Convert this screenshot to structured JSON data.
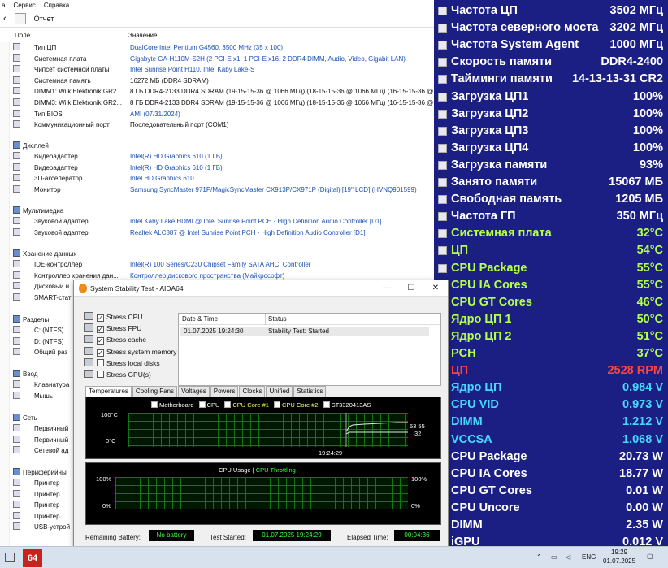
{
  "menu": [
    "а",
    "Сервис",
    "Справка"
  ],
  "toolbar": {
    "report": "Отчет"
  },
  "columns": {
    "field": "Поле",
    "value": "Значение"
  },
  "rows": [
    {
      "f": "Тип ЦП",
      "v": "DualCore Intel Pentium G4560, 3500 MHz (35 x 100)",
      "link": true
    },
    {
      "f": "Системная плата",
      "v": "Gigabyte GA-H110M-S2H  (2 PCI-E x1, 1 PCI-E x16, 2 DDR4 DIMM, Audio, Video, Gigabit LAN)",
      "link": true
    },
    {
      "f": "Чипсет системной платы",
      "v": "Intel Sunrise Point H110, Intel Kaby Lake-S",
      "link": true
    },
    {
      "f": "Системная память",
      "v": "16272 МБ  (DDR4 SDRAM)",
      "link": false
    },
    {
      "f": "DIMM1: Wilk Elektronik GR2...",
      "v": "8 ГБ DDR4-2133 DDR4 SDRAM  (19-15-15-36 @ 1066 МГц)  (18-15-15-36 @ 1066 МГц)  (16-15-15-36 @",
      "link": false
    },
    {
      "f": "DIMM3: Wilk Elektronik GR2...",
      "v": "8 ГБ DDR4-2133 DDR4 SDRAM  (19-15-15-36 @ 1066 МГц)  (18-15-15-36 @ 1066 МГц)  (16-15-15-36 @",
      "link": false
    },
    {
      "f": "Тип BIOS",
      "v": "AMI (07/31/2024)",
      "link": true
    },
    {
      "f": "Коммуникационный порт",
      "v": "Последовательный порт (COM1)",
      "link": false
    }
  ],
  "display": {
    "title": "Дисплей",
    "rows": [
      {
        "f": "Видеоадаптер",
        "v": "Intel(R) HD Graphics 610  (1 ГБ)"
      },
      {
        "f": "Видеоадаптер",
        "v": "Intel(R) HD Graphics 610  (1 ГБ)"
      },
      {
        "f": "3D-акселератор",
        "v": "Intel HD Graphics 610"
      },
      {
        "f": "Монитор",
        "v": "Samsung SyncMaster 971P/MagicSyncMaster CX913P/CX971P (Digital)  [19\" LCD]  (HVNQ901599)"
      }
    ]
  },
  "multimedia": {
    "title": "Мультимедиа",
    "rows": [
      {
        "f": "Звуковой адаптер",
        "v": "Intel Kaby Lake HDMI @ Intel Sunrise Point PCH - High Definition Audio Controller [D1]"
      },
      {
        "f": "Звуковой адаптер",
        "v": "Realtek ALC887 @ Intel Sunrise Point PCH - High Definition Audio Controller [D1]"
      }
    ]
  },
  "storage": {
    "title": "Хранение данных",
    "rows": [
      {
        "f": "IDE-контроллер",
        "v": "Intel(R) 100 Series/C230 Chipset Family SATA AHCI Controller"
      },
      {
        "f": "Контроллер хранения дан...",
        "v": "Контроллер дискового пространства (Майкрософт)"
      },
      {
        "f": "Дисковый н",
        "v": ""
      },
      {
        "f": "SMART-стат",
        "v": ""
      }
    ]
  },
  "partitions": {
    "title": "Разделы",
    "rows": [
      "C: (NTFS)",
      "D: (NTFS)",
      "Общий раз"
    ]
  },
  "input": {
    "title": "Ввод",
    "rows": [
      "Клавиатура",
      "Мышь"
    ]
  },
  "network": {
    "title": "Сеть",
    "rows": [
      "Первичный",
      "Первичный",
      "Сетевой ад"
    ]
  },
  "peripherals": {
    "title": "Периферийны",
    "rows": [
      "Принтер",
      "Принтер",
      "Принтер",
      "Принтер",
      "USB-устрой"
    ]
  },
  "osd": [
    {
      "l": "Частота ЦП",
      "v": "3502 МГц",
      "c": "w"
    },
    {
      "l": "Частота северного моста",
      "v": "3202 МГц",
      "c": "w"
    },
    {
      "l": "Частота System Agent",
      "v": "1000 МГц",
      "c": "w"
    },
    {
      "l": "Скорость памяти",
      "v": "DDR4-2400",
      "c": "w"
    },
    {
      "l": "Тайминги памяти",
      "v": "14-13-13-31 CR2",
      "c": "w"
    },
    {
      "l": "Загрузка ЦП1",
      "v": "100%",
      "c": "w"
    },
    {
      "l": "Загрузка ЦП2",
      "v": "100%",
      "c": "w"
    },
    {
      "l": "Загрузка ЦП3",
      "v": "100%",
      "c": "w"
    },
    {
      "l": "Загрузка ЦП4",
      "v": "100%",
      "c": "w"
    },
    {
      "l": "Загрузка памяти",
      "v": "93%",
      "c": "w"
    },
    {
      "l": "Занято памяти",
      "v": "15067 МБ",
      "c": "w"
    },
    {
      "l": "Свободная память",
      "v": "1205 МБ",
      "c": "w"
    },
    {
      "l": "Частота ГП",
      "v": "350 МГц",
      "c": "w"
    },
    {
      "l": "Системная плата",
      "v": "32°C",
      "c": "g"
    },
    {
      "l": "ЦП",
      "v": "54°C",
      "c": "g"
    },
    {
      "l": "CPU Package",
      "v": "55°C",
      "c": "g"
    },
    {
      "l": "CPU IA Cores",
      "v": "55°C",
      "c": "g"
    },
    {
      "l": "CPU GT Cores",
      "v": "46°C",
      "c": "g"
    },
    {
      "l": "Ядро ЦП 1",
      "v": "50°C",
      "c": "g"
    },
    {
      "l": "Ядро ЦП 2",
      "v": "51°C",
      "c": "g"
    },
    {
      "l": "PCH",
      "v": "37°C",
      "c": "g"
    },
    {
      "l": "ЦП",
      "v": "2528 RPM",
      "c": "r"
    },
    {
      "l": "Ядро ЦП",
      "v": "0.984 V",
      "c": "c"
    },
    {
      "l": "CPU VID",
      "v": "0.973 V",
      "c": "c"
    },
    {
      "l": "DIMM",
      "v": "1.212 V",
      "c": "c"
    },
    {
      "l": "VCCSA",
      "v": "1.068 V",
      "c": "c"
    },
    {
      "l": "CPU Package",
      "v": "20.73 W",
      "c": "w"
    },
    {
      "l": "CPU IA Cores",
      "v": "18.77 W",
      "c": "w"
    },
    {
      "l": "CPU GT Cores",
      "v": "0.01 W",
      "c": "w"
    },
    {
      "l": "CPU Uncore",
      "v": "0.00 W",
      "c": "w"
    },
    {
      "l": "DIMM",
      "v": "2.35 W",
      "c": "w"
    },
    {
      "l": "iGPU",
      "v": "0.012 V",
      "c": "w"
    }
  ],
  "sst": {
    "title": "System Stability Test - AIDA64",
    "checks": [
      {
        "l": "Stress CPU",
        "on": true
      },
      {
        "l": "Stress FPU",
        "on": true
      },
      {
        "l": "Stress cache",
        "on": true
      },
      {
        "l": "Stress system memory",
        "on": true
      },
      {
        "l": "Stress local disks",
        "on": false
      },
      {
        "l": "Stress GPU(s)",
        "on": false
      }
    ],
    "log_headers": {
      "date": "Date & Time",
      "status": "Status"
    },
    "log_row": {
      "date": "01.07.2025 19:24:30",
      "status": "Stability Test: Started"
    },
    "tabs": [
      "Temperatures",
      "Cooling Fans",
      "Voltages",
      "Powers",
      "Clocks",
      "Unified",
      "Statistics"
    ],
    "temp_legend": [
      "Motherboard",
      "CPU",
      "CPU Core #1",
      "CPU Core #2",
      "ST3320413AS"
    ],
    "temp_top": "100°C",
    "temp_bot": "0°C",
    "temp_time": "19:24:29",
    "temp_vals": [
      "53 55",
      "32"
    ],
    "usage_title": "CPU Usage",
    "usage_sep": "|",
    "usage_throttle": "CPU Throttling",
    "pct_top": "100%",
    "pct_bot": "0%",
    "rem_label": "Remaining Battery:",
    "rem_val": "No battery",
    "start_label": "Test Started:",
    "start_val": "01.07.2025 19:24:29",
    "elapsed_label": "Elapsed Time:",
    "elapsed_val": "00:04:36"
  },
  "taskbar": {
    "app": "64",
    "lang": "ENG",
    "time": "19:29",
    "date": "01.07.2025"
  }
}
